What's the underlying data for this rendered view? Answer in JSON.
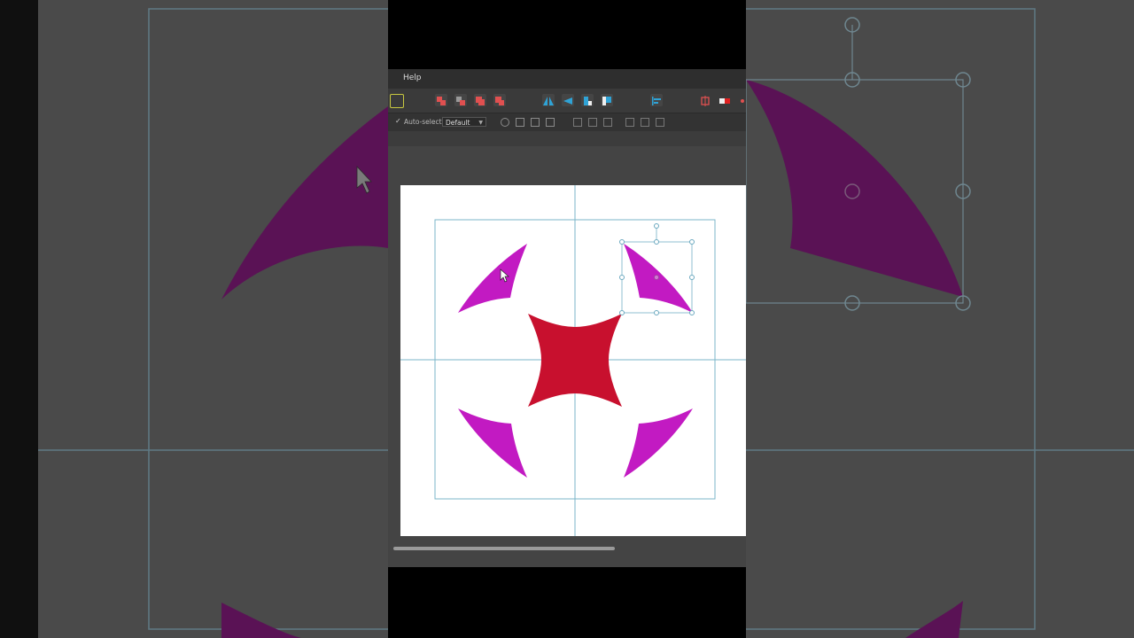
{
  "app": {
    "menu": {
      "help_label": "Help"
    },
    "context_toolbar": {
      "auto_select_label": "Auto-select:",
      "auto_select_value": "Default",
      "auto_select_checked": true
    },
    "canvas": {
      "background": "#ffffff",
      "guide_color": "#7bb6c9",
      "selected_shape": "top-right-spike",
      "shapes": [
        {
          "name": "cross-pattee",
          "color": "#c8102e"
        },
        {
          "name": "spike-top-left",
          "color": "#c21ac2"
        },
        {
          "name": "spike-top-right",
          "color": "#c21ac2"
        },
        {
          "name": "spike-bottom-left",
          "color": "#c21ac2"
        },
        {
          "name": "spike-bottom-right",
          "color": "#c21ac2"
        }
      ]
    },
    "colors": {
      "ui_dark": "#2e2e2e",
      "ui_toolbar": "#3a3a3a",
      "workspace": "#444444",
      "dimmed_bg": "#4a4a4a",
      "dimmed_shape": "#5c1257",
      "accent_red": "#e05050",
      "accent_blue": "#2fa3d6"
    }
  }
}
